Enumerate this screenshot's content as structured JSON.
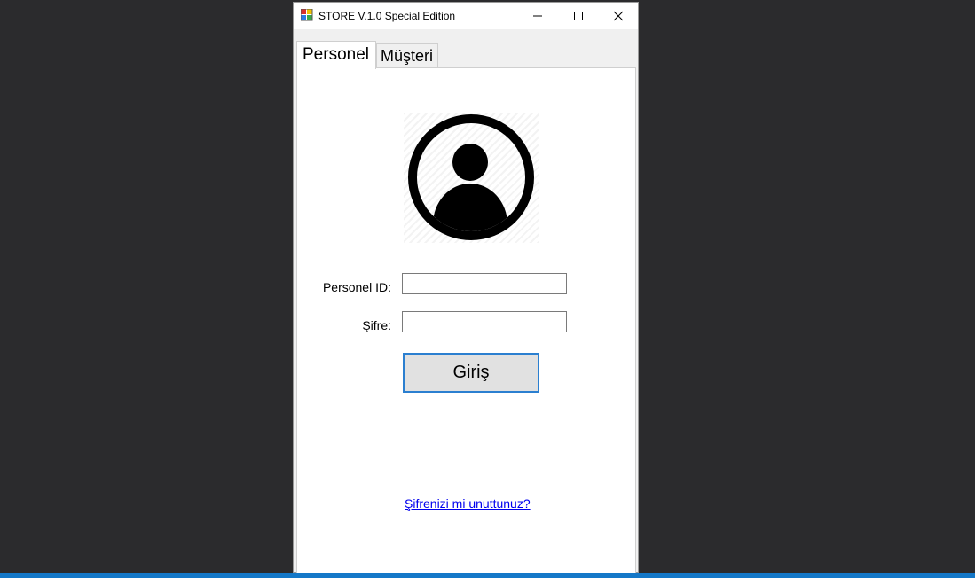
{
  "window": {
    "title": "STORE V.1.0 Special Edition"
  },
  "tabs": [
    {
      "label": "Personel",
      "active": true
    },
    {
      "label": "Müşteri",
      "active": false
    }
  ],
  "form": {
    "id_label": "Personel ID:",
    "id_value": "",
    "password_label": "Şifre:",
    "password_value": "",
    "login_label": "Giriş",
    "forgot_link": "Şifrenizi mi unuttunuz?"
  },
  "icons": {
    "avatar": "user-circle-icon"
  },
  "colors": {
    "desktop": "#2b2b2d",
    "accent": "#2b7fd0",
    "link": "#0000ee",
    "taskbar": "#1478c8"
  }
}
